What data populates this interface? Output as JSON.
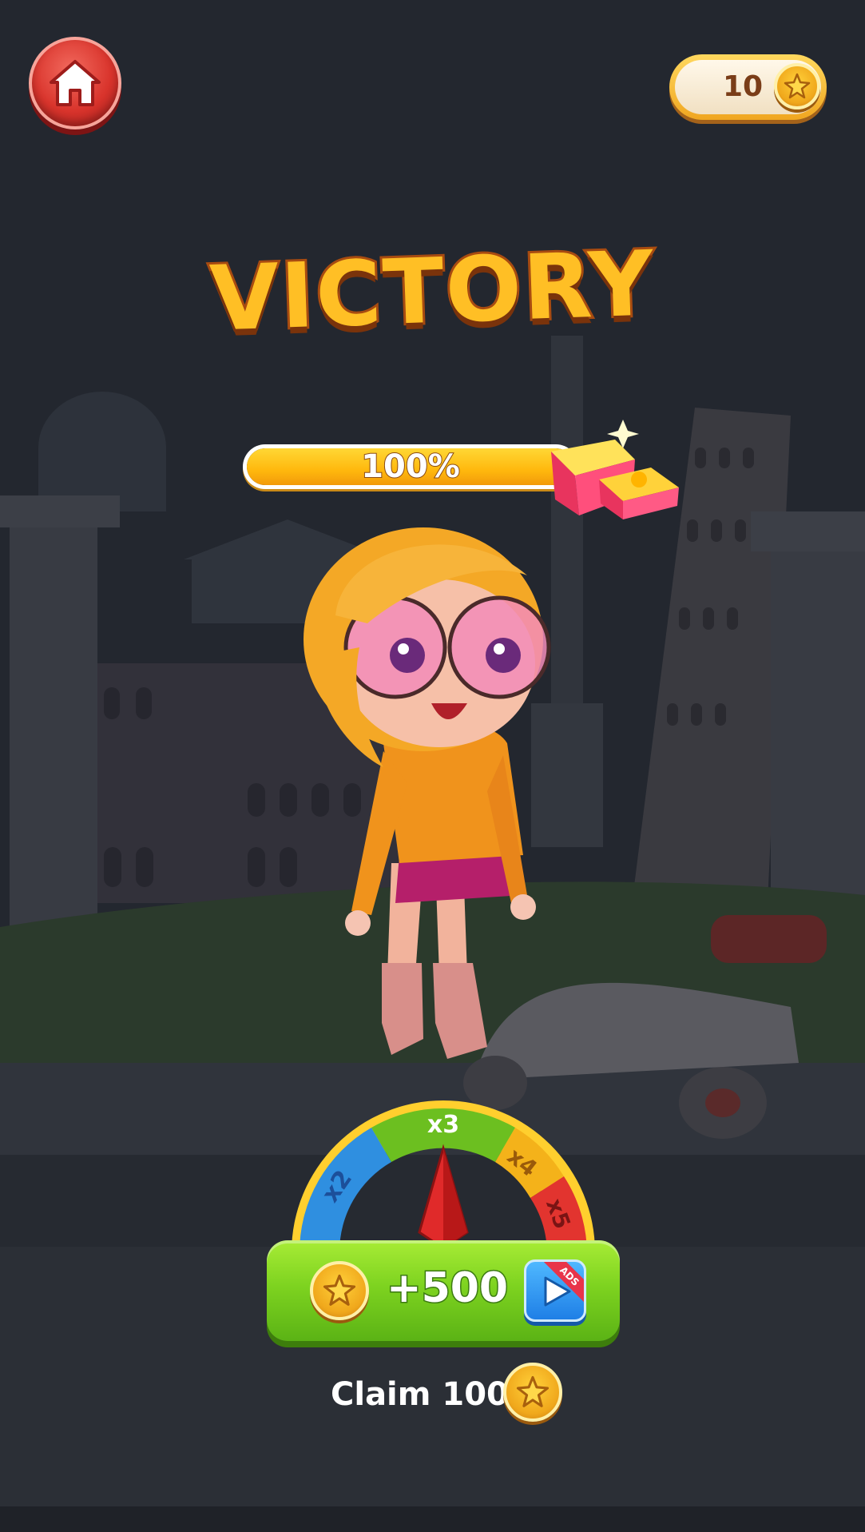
{
  "header": {
    "home_icon": "home-icon",
    "coins": "10",
    "coin_icon": "star-coin-icon"
  },
  "title": "VICTORY",
  "progress": {
    "label": "100%",
    "value": 1.0,
    "reward_icon": "gift-box-icon"
  },
  "multiplier_wheel": {
    "segments": [
      {
        "label": "x2",
        "color": "#2f8fe0"
      },
      {
        "label": "x3",
        "color": "#6cbf20"
      },
      {
        "label": "x4",
        "color": "#f4b21a"
      },
      {
        "label": "x5",
        "color": "#e2342f"
      }
    ],
    "pointer_icon": "red-pointer-icon"
  },
  "reward_button": {
    "amount": "+500",
    "ads_badge": "ADS",
    "play_icon": "play-icon"
  },
  "claim": {
    "label": "Claim 100"
  },
  "colors": {
    "background": "#23272f",
    "title": "#ffbf25",
    "reward_button": "#7ed320",
    "home_button": "#d9342c"
  }
}
